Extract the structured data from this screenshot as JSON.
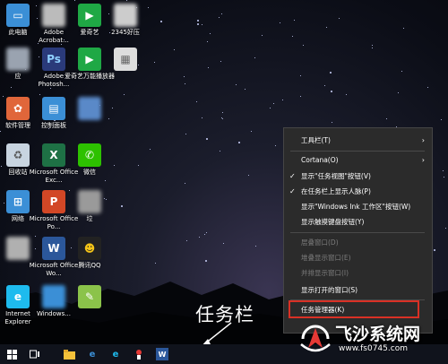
{
  "desktop_icons": [
    {
      "label": "此电脑",
      "icon": "pc-icon",
      "color": "#3b8fd6"
    },
    {
      "label": "Adobe Acrobat...",
      "icon": "acrobat-icon",
      "color": "#bbbbbb"
    },
    {
      "label": "爱奇艺",
      "icon": "iqiyi-icon",
      "color": "#1fa845"
    },
    {
      "label": "2345好压",
      "icon": "archive-icon",
      "color": "#cccccc"
    },
    {
      "label": "应",
      "icon": "app-icon",
      "color": "#9aa3b0"
    },
    {
      "label": "Adobe Photosh...",
      "icon": "photoshop-icon",
      "color": "#2a3a7a"
    },
    {
      "label": "爱奇艺万能播放器",
      "icon": "iqiyi-player-icon",
      "color": "#1fa845"
    },
    {
      "label": "",
      "icon": "document-icon",
      "color": "#dddddd"
    },
    {
      "label": "软件管理",
      "icon": "software-manager-icon",
      "color": "#e0663a"
    },
    {
      "label": "控制面板",
      "icon": "control-panel-icon",
      "color": "#3b8fd6"
    },
    {
      "label": "",
      "icon": "blurred-icon",
      "color": "#5a89c8"
    },
    {
      "label": "回收站",
      "icon": "recycle-bin-icon",
      "color": "#c8d4e0"
    },
    {
      "label": "Microsoft Office Exc...",
      "icon": "excel-icon",
      "color": "#1e7145"
    },
    {
      "label": "微信",
      "icon": "wechat-icon",
      "color": "#2dc100"
    },
    {
      "label": "网络",
      "icon": "network-icon",
      "color": "#3b8fd6"
    },
    {
      "label": "Microsoft Office Po...",
      "icon": "powerpoint-icon",
      "color": "#d24726"
    },
    {
      "label": "垃",
      "icon": "blurred-icon",
      "color": "#9a9a9a"
    },
    {
      "label": "",
      "icon": "blurred-icon",
      "color": "#b0b0b0"
    },
    {
      "label": "Microsoft Office Wo...",
      "icon": "word-icon",
      "color": "#2b579a"
    },
    {
      "label": "腾讯QQ",
      "icon": "qq-icon",
      "color": "#222222"
    },
    {
      "label": "Internet Explorer",
      "icon": "ie-icon",
      "color": "#1ebbee"
    },
    {
      "label": "Windows...",
      "icon": "blurred-icon",
      "color": "#3b8fd6"
    },
    {
      "label": "",
      "icon": "notepad-icon",
      "color": "#8bc34a"
    }
  ],
  "context_menu": {
    "items": [
      {
        "label": "工具栏(T)",
        "submenu": true,
        "checked": false,
        "disabled": false
      },
      {
        "label": "Cortana(O)",
        "submenu": true,
        "checked": false,
        "disabled": false
      },
      {
        "label": "显示\"任务视图\"按钮(V)",
        "submenu": false,
        "checked": true,
        "disabled": false
      },
      {
        "label": "在任务栏上显示人脉(P)",
        "submenu": false,
        "checked": true,
        "disabled": false
      },
      {
        "label": "显示\"Windows Ink 工作区\"按钮(W)",
        "submenu": false,
        "checked": false,
        "disabled": false
      },
      {
        "label": "显示触摸键盘按钮(Y)",
        "submenu": false,
        "checked": false,
        "disabled": false
      },
      {
        "label": "层叠窗口(D)",
        "submenu": false,
        "checked": false,
        "disabled": true
      },
      {
        "label": "堆叠显示窗口(E)",
        "submenu": false,
        "checked": false,
        "disabled": true
      },
      {
        "label": "并排显示窗口(I)",
        "submenu": false,
        "checked": false,
        "disabled": true
      },
      {
        "label": "显示打开的窗口(S)",
        "submenu": false,
        "checked": false,
        "disabled": false
      },
      {
        "label": "任务管理器(K)",
        "submenu": false,
        "checked": false,
        "disabled": false
      }
    ]
  },
  "annotation": {
    "label": "任务栏"
  },
  "watermark": {
    "title": "飞沙系统网",
    "url": "www.fs0745.com"
  },
  "taskbar": {
    "icons": [
      "windows-start-icon",
      "task-view-icon",
      "file-explorer-icon",
      "edge-icon",
      "ie-icon",
      "app-icon",
      "word-icon"
    ]
  },
  "colors": {
    "highlight_border": "#d93025",
    "menu_bg": "#2b2b2b",
    "taskbar_bg": "#10131c"
  }
}
